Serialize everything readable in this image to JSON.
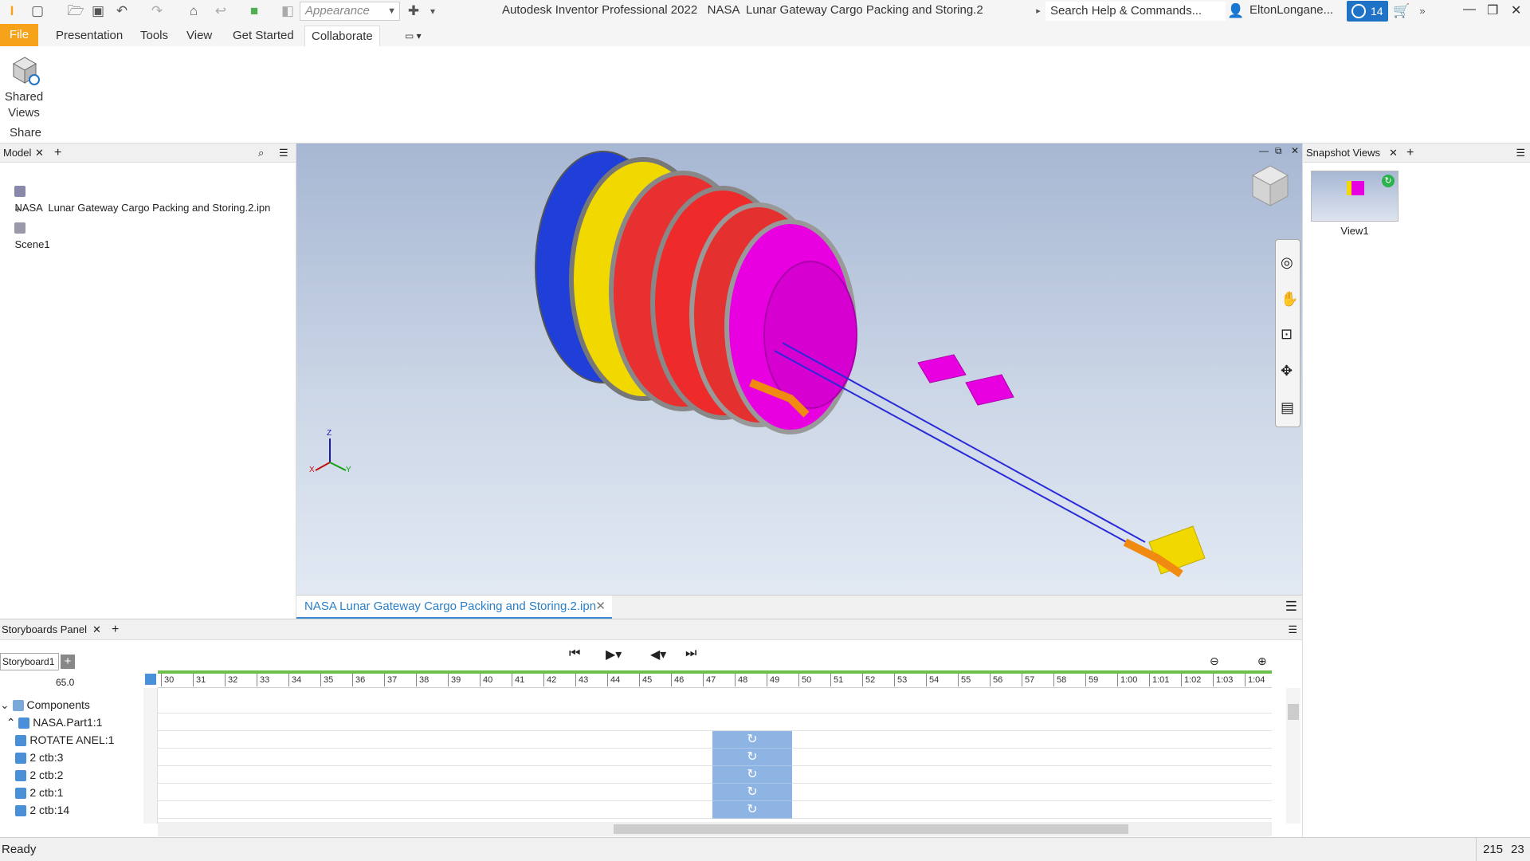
{
  "window": {
    "title": "Autodesk Inventor Professional 2022   NASA  Lunar Gateway Cargo Packing and Storing.2",
    "appearance_placeholder": "Appearance",
    "search_placeholder": "Search Help & Commands...",
    "user": "EltonLongane...",
    "notification_count": "14",
    "accent": "#1e73c7"
  },
  "ribbon": {
    "tabs": [
      "File",
      "Presentation",
      "Tools",
      "View",
      "Get Started",
      "Collaborate"
    ],
    "active_tab": "Collaborate",
    "file_color": "#f6a21a",
    "button": "Shared Views",
    "panel_label": "Share"
  },
  "model_browser": {
    "title": "Model",
    "root": "NASA  Lunar Gateway Cargo Packing and Storing.2.ipn",
    "child": "Scene1"
  },
  "viewport": {
    "doc_tab": "NASA  Lunar Gateway Cargo Packing and Storing.2.ipn",
    "axis_labels": [
      "X",
      "Y",
      "Z"
    ]
  },
  "snapshot_panel": {
    "title": "Snapshot Views",
    "items": [
      "View1"
    ]
  },
  "storyboard": {
    "panel_title": "Storyboards Panel",
    "tab": "Storyboard1",
    "current_time": "65.0",
    "ticks": [
      "30",
      "31",
      "32",
      "33",
      "34",
      "35",
      "36",
      "37",
      "38",
      "39",
      "40",
      "41",
      "42",
      "43",
      "44",
      "45",
      "46",
      "47",
      "48",
      "49",
      "50",
      "51",
      "52",
      "53",
      "54",
      "55",
      "56",
      "57",
      "58",
      "59",
      "1:00",
      "1:01",
      "1:02",
      "1:03",
      "1:04"
    ],
    "tree": [
      "Components",
      "NASA.Part1:1",
      "ROTATE ANEL:1",
      "2 ctb:3",
      "2 ctb:2",
      "2 ctb:1",
      "2 ctb:14"
    ]
  },
  "status": {
    "text": "Ready",
    "num1": "215",
    "num2": "23"
  }
}
